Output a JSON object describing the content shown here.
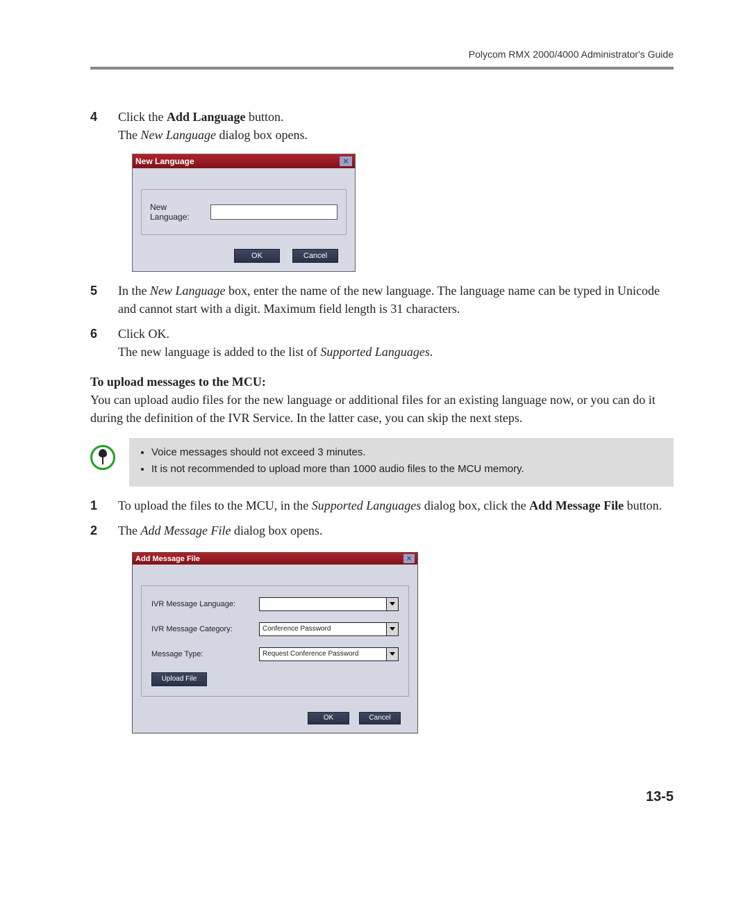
{
  "header": "Polycom RMX 2000/4000 Administrator's Guide",
  "steps1": {
    "n4": "4",
    "s4a": "Click the ",
    "s4b_bold": "Add Language",
    "s4c": " button.",
    "s4d": "The ",
    "s4e_ital": "New Language",
    "s4f": " dialog box opens.",
    "n5": "5",
    "s5a": "In the ",
    "s5b_ital": "New Language",
    "s5c": " box, enter the name of the new language. The language name can be typed in Unicode and cannot start with a digit. Maximum field length is 31 characters.",
    "n6": "6",
    "s6a": "Click OK.",
    "s6b": "The new language is added to the list of ",
    "s6c_ital": "Supported Languages",
    "s6d": "."
  },
  "dlg1": {
    "title": "New Language",
    "label": "New Language:",
    "ok": "OK",
    "cancel": "Cancel",
    "close": "×"
  },
  "uploadHead": "To upload messages to the MCU:",
  "uploadPara": "You can upload audio files for the new language or additional files for an existing language now, or you can do it during the definition of the IVR Service. In the latter case, you can skip the next steps.",
  "note": {
    "b1": "Voice messages should not exceed 3 minutes.",
    "b2": "It is not recommended to upload more than 1000 audio files to the MCU memory."
  },
  "steps2": {
    "n1": "1",
    "s1a": "To upload the files to the MCU, in the ",
    "s1b_ital": "Supported Languages",
    "s1c": " dialog box, click the ",
    "s1d_bold": "Add Message File",
    "s1e": " button.",
    "n2": "2",
    "s2a": "The ",
    "s2b_ital": "Add Message File",
    "s2c": " dialog box opens."
  },
  "dlg2": {
    "title": "Add Message File",
    "close": "×",
    "lbl_lang": "IVR Message Language:",
    "val_lang": "",
    "lbl_cat": "IVR Message Category:",
    "val_cat": "Conference Password",
    "lbl_type": "Message Type:",
    "val_type": "Request Conference Password",
    "upload": "Upload File",
    "ok": "OK",
    "cancel": "Cancel"
  },
  "pageNum": "13-5"
}
